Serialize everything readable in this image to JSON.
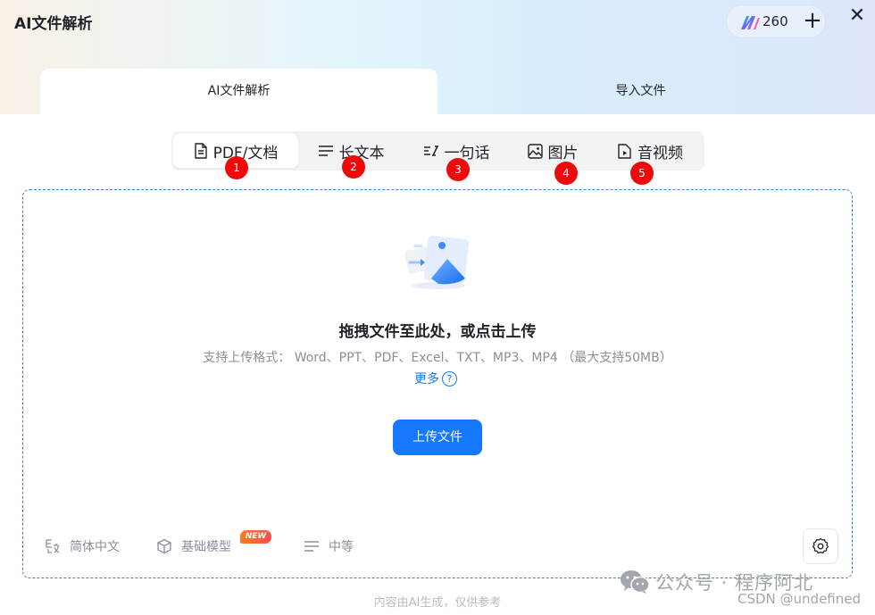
{
  "app": {
    "title": "AI文件解析"
  },
  "credits": {
    "count": "260",
    "add_label": "+"
  },
  "close_label": "✕",
  "main_tabs": [
    {
      "label": "AI文件解析",
      "active": true
    },
    {
      "label": "导入文件",
      "active": false
    }
  ],
  "file_types": [
    {
      "label": "PDF/文档",
      "icon": "document-icon",
      "badge": "1",
      "active": true
    },
    {
      "label": "长文本",
      "icon": "text-lines-icon",
      "badge": "2",
      "active": false
    },
    {
      "label": "一句话",
      "icon": "sentence-icon",
      "badge": "3",
      "active": false
    },
    {
      "label": "图片",
      "icon": "image-icon",
      "badge": "4",
      "active": false
    },
    {
      "label": "音视频",
      "icon": "video-icon",
      "badge": "5",
      "active": false
    }
  ],
  "dropzone": {
    "title": "拖拽文件至此处，或点击上传",
    "formats": "支持上传格式： Word、PPT、PDF、Excel、TXT、MP3、MP4 （最大支持50MB）",
    "more_label": "更多",
    "help_label": "?",
    "upload_label": "上传文件"
  },
  "options": {
    "language": "简体中文",
    "model": "基础模型",
    "new_tag": "NEW",
    "level": "中等"
  },
  "footer_note": "内容由AI生成，仅供参考",
  "watermark": {
    "wechat": "公众号 · 程序阿北",
    "csdn": "CSDN @undefined"
  },
  "colors": {
    "accent": "#1677ff",
    "badge": "#ee0a0a",
    "border_dashed": "#3c7ddc"
  }
}
